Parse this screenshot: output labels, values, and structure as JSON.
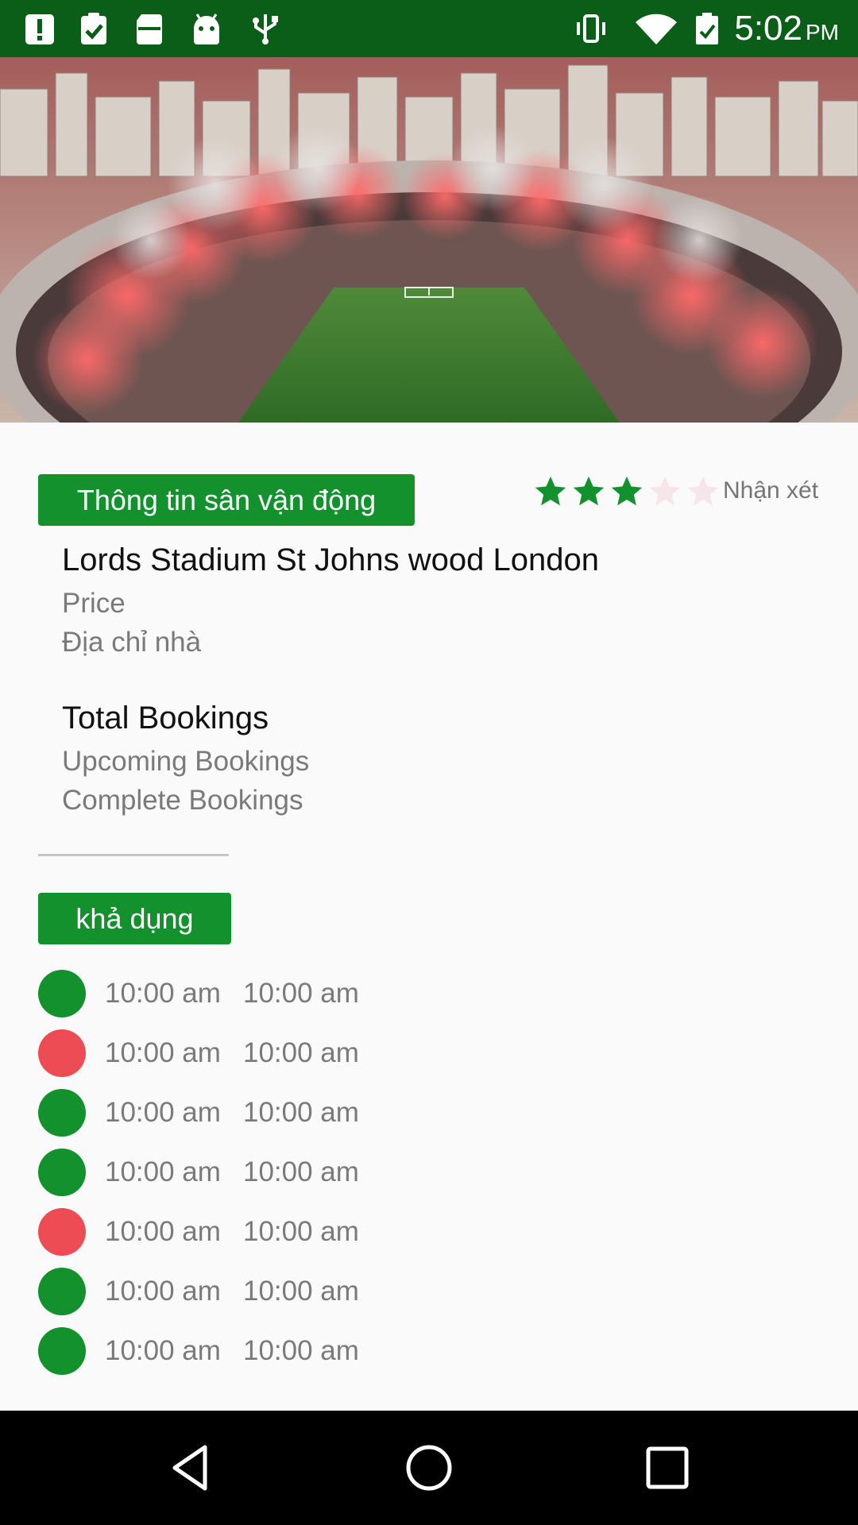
{
  "status_bar": {
    "time": "5:02",
    "ampm": "PM",
    "left_icons": [
      "alert-icon",
      "clipboard-check-icon",
      "sd-card-icon",
      "android-icon",
      "usb-icon"
    ],
    "right_icons": [
      "vibrate-icon",
      "wifi-icon",
      "battery-icon"
    ],
    "background": "#0b5e17"
  },
  "hero": {
    "subject": "stadium-photo"
  },
  "info": {
    "tag_label": "Thông tin sân vận động",
    "rating": 3,
    "rating_max": 5,
    "review_label": "Nhận xét",
    "stadium_name": "Lords Stadium St Johns wood London",
    "price_label": "Price",
    "address_label": "Địa chỉ nhà"
  },
  "bookings": {
    "total_label": "Total Bookings",
    "upcoming_label": "Upcoming Bookings",
    "complete_label": "Complete Bookings"
  },
  "availability": {
    "label": "khả dụng",
    "slots": [
      {
        "start": "10:00 am",
        "end": "10:00 am",
        "status": "available"
      },
      {
        "start": "10:00 am",
        "end": "10:00 am",
        "status": "booked"
      },
      {
        "start": "10:00 am",
        "end": "10:00 am",
        "status": "available"
      },
      {
        "start": "10:00 am",
        "end": "10:00 am",
        "status": "available"
      },
      {
        "start": "10:00 am",
        "end": "10:00 am",
        "status": "booked"
      },
      {
        "start": "10:00 am",
        "end": "10:00 am",
        "status": "available"
      },
      {
        "start": "10:00 am",
        "end": "10:00 am",
        "status": "available"
      }
    ]
  },
  "colors": {
    "accent": "#12912d",
    "available": "#12912d",
    "booked": "#ee4c55",
    "star_on": "#12912d",
    "star_off": "#f6e6ea"
  },
  "nav_bar": {
    "back": "back-icon",
    "home": "home-icon",
    "recents": "recents-icon"
  }
}
